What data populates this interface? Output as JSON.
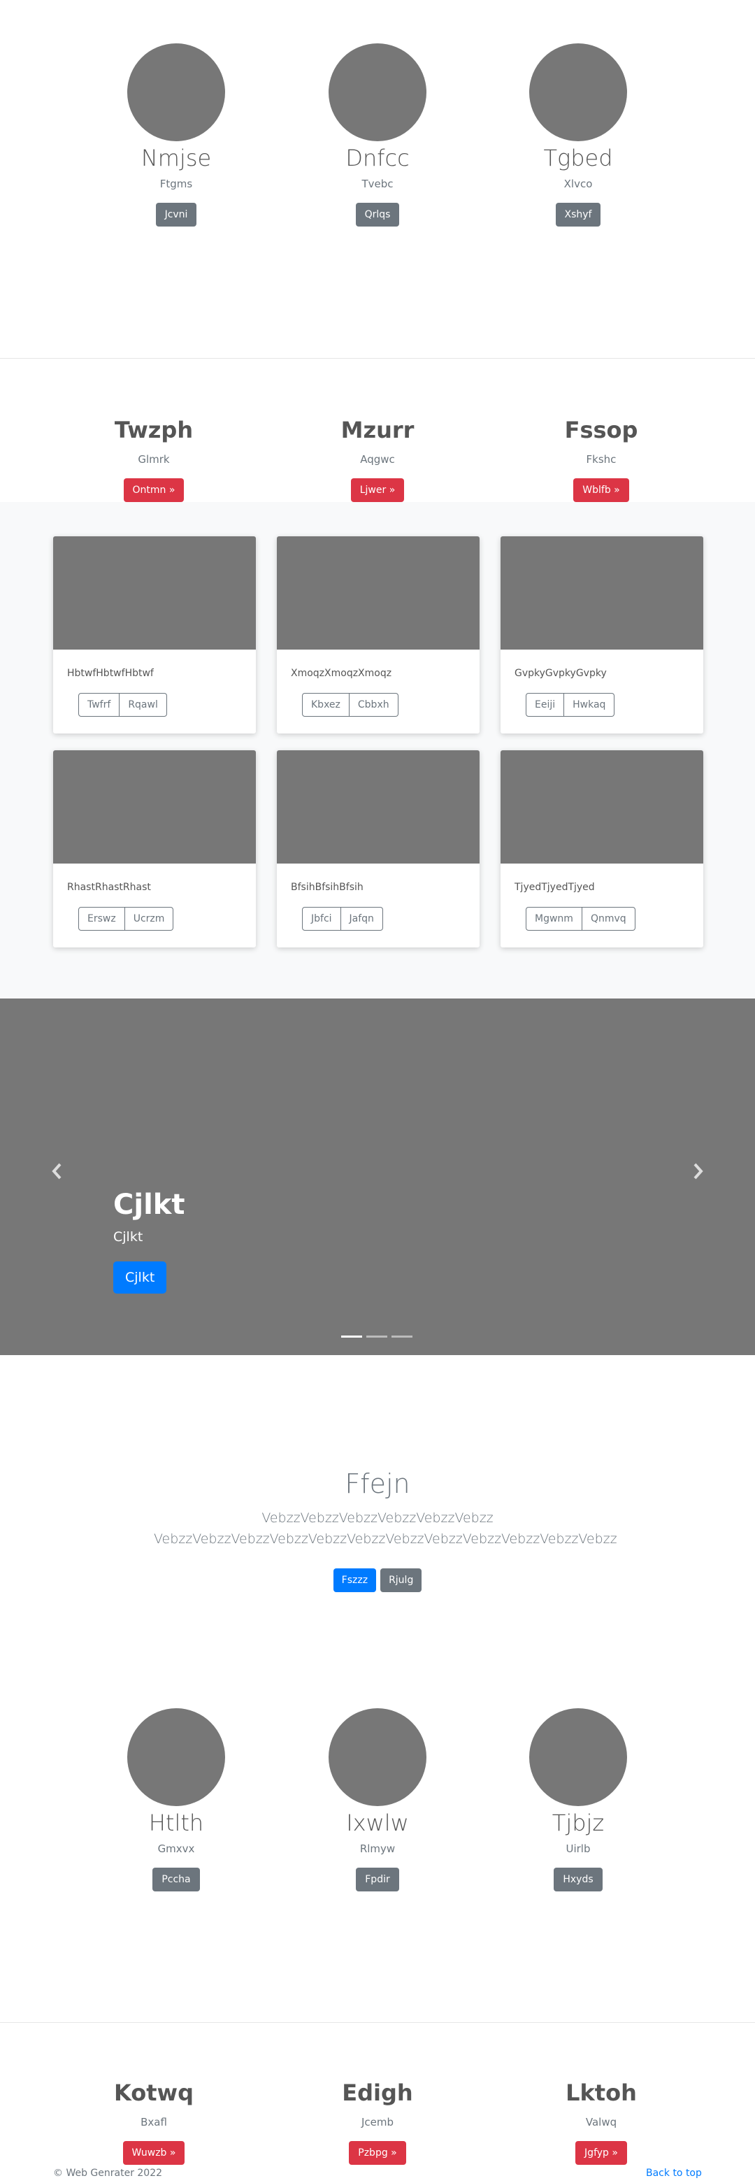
{
  "profiles_top": [
    {
      "name": "Nmjse",
      "sub": "Ftgms",
      "button": "Jcvni"
    },
    {
      "name": "Dnfcc",
      "sub": "Tvebc",
      "button": "Qrlqs"
    },
    {
      "name": "Tgbed",
      "sub": "Xlvco",
      "button": "Xshyf"
    }
  ],
  "headings_top": [
    {
      "name": "Twzph",
      "sub": "Glmrk",
      "button": "Ontmn »"
    },
    {
      "name": "Mzurr",
      "sub": "Aqgwc",
      "button": "Ljwer »"
    },
    {
      "name": "Fssop",
      "sub": "Fkshc",
      "button": "Wblfb »"
    }
  ],
  "cards": [
    {
      "text": "HbtwfHbtwfHbtwf",
      "buttons": [
        "Twfrf",
        "Rqawl"
      ]
    },
    {
      "text": "XmoqzXmoqzXmoqz",
      "buttons": [
        "Kbxez",
        "Cbbxh"
      ]
    },
    {
      "text": "GvpkyGvpkyGvpky",
      "buttons": [
        "Eeiji",
        "Hwkaq"
      ]
    },
    {
      "text": "RhastRhastRhast",
      "buttons": [
        "Erswz",
        "Ucrzm"
      ]
    },
    {
      "text": "BfsihBfsihBfsih",
      "buttons": [
        "Jbfci",
        "Jafqn"
      ]
    },
    {
      "text": "TjyedTjyedTjyed",
      "buttons": [
        "Mgwnm",
        "Qnmvq"
      ]
    }
  ],
  "carousel": {
    "title": "Cjlkt",
    "subtitle": "Cjlkt",
    "button": "Cjlkt"
  },
  "jumbotron": {
    "title": "Ffejn",
    "lead": "VebzzVebzzVebzzVebzzVebzzVebzz VebzzVebzzVebzzVebzzVebzzVebzzVebzzVebzzVebzzVebzzVebzzVebzz",
    "primary_button": "Fszzz",
    "secondary_button": "Rjulg"
  },
  "profiles_bottom": [
    {
      "name": "Htlth",
      "sub": "Gmxvx",
      "button": "Pccha"
    },
    {
      "name": "Ixwlw",
      "sub": "Rlmyw",
      "button": "Fpdir"
    },
    {
      "name": "Tjbjz",
      "sub": "Uirlb",
      "button": "Hxyds"
    }
  ],
  "headings_bottom": [
    {
      "name": "Kotwq",
      "sub": "Bxafl",
      "button": "Wuwzb »"
    },
    {
      "name": "Edigh",
      "sub": "Jcemb",
      "button": "Pzbpg »"
    },
    {
      "name": "Lktoh",
      "sub": "Valwq",
      "button": "Jgfyp »"
    }
  ],
  "footer": {
    "copyright": "© Web Genrater 2022",
    "back_to_top": "Back to top"
  },
  "colors": {
    "primary": "#007bff",
    "danger": "#dc3545",
    "secondary": "#6c757d",
    "placeholder": "#777777"
  }
}
